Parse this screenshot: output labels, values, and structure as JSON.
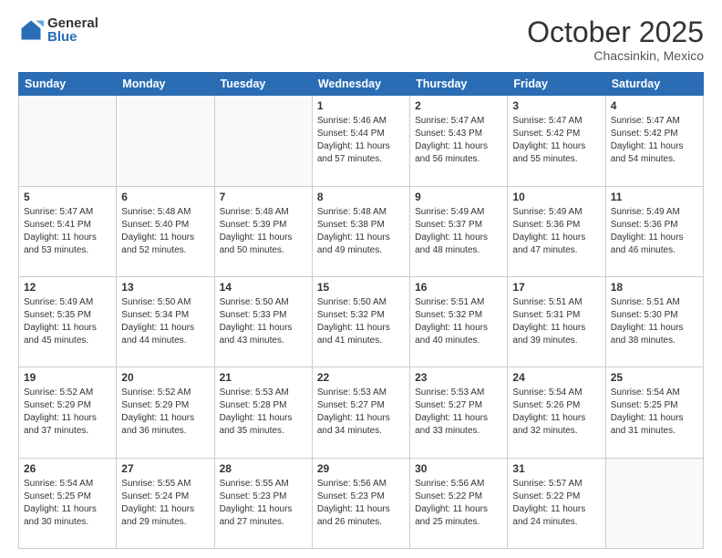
{
  "header": {
    "logo_general": "General",
    "logo_blue": "Blue",
    "month_title": "October 2025",
    "location": "Chacsinkin, Mexico"
  },
  "weekdays": [
    "Sunday",
    "Monday",
    "Tuesday",
    "Wednesday",
    "Thursday",
    "Friday",
    "Saturday"
  ],
  "weeks": [
    [
      {
        "day": "",
        "info": ""
      },
      {
        "day": "",
        "info": ""
      },
      {
        "day": "",
        "info": ""
      },
      {
        "day": "1",
        "info": "Sunrise: 5:46 AM\nSunset: 5:44 PM\nDaylight: 11 hours\nand 57 minutes."
      },
      {
        "day": "2",
        "info": "Sunrise: 5:47 AM\nSunset: 5:43 PM\nDaylight: 11 hours\nand 56 minutes."
      },
      {
        "day": "3",
        "info": "Sunrise: 5:47 AM\nSunset: 5:42 PM\nDaylight: 11 hours\nand 55 minutes."
      },
      {
        "day": "4",
        "info": "Sunrise: 5:47 AM\nSunset: 5:42 PM\nDaylight: 11 hours\nand 54 minutes."
      }
    ],
    [
      {
        "day": "5",
        "info": "Sunrise: 5:47 AM\nSunset: 5:41 PM\nDaylight: 11 hours\nand 53 minutes."
      },
      {
        "day": "6",
        "info": "Sunrise: 5:48 AM\nSunset: 5:40 PM\nDaylight: 11 hours\nand 52 minutes."
      },
      {
        "day": "7",
        "info": "Sunrise: 5:48 AM\nSunset: 5:39 PM\nDaylight: 11 hours\nand 50 minutes."
      },
      {
        "day": "8",
        "info": "Sunrise: 5:48 AM\nSunset: 5:38 PM\nDaylight: 11 hours\nand 49 minutes."
      },
      {
        "day": "9",
        "info": "Sunrise: 5:49 AM\nSunset: 5:37 PM\nDaylight: 11 hours\nand 48 minutes."
      },
      {
        "day": "10",
        "info": "Sunrise: 5:49 AM\nSunset: 5:36 PM\nDaylight: 11 hours\nand 47 minutes."
      },
      {
        "day": "11",
        "info": "Sunrise: 5:49 AM\nSunset: 5:36 PM\nDaylight: 11 hours\nand 46 minutes."
      }
    ],
    [
      {
        "day": "12",
        "info": "Sunrise: 5:49 AM\nSunset: 5:35 PM\nDaylight: 11 hours\nand 45 minutes."
      },
      {
        "day": "13",
        "info": "Sunrise: 5:50 AM\nSunset: 5:34 PM\nDaylight: 11 hours\nand 44 minutes."
      },
      {
        "day": "14",
        "info": "Sunrise: 5:50 AM\nSunset: 5:33 PM\nDaylight: 11 hours\nand 43 minutes."
      },
      {
        "day": "15",
        "info": "Sunrise: 5:50 AM\nSunset: 5:32 PM\nDaylight: 11 hours\nand 41 minutes."
      },
      {
        "day": "16",
        "info": "Sunrise: 5:51 AM\nSunset: 5:32 PM\nDaylight: 11 hours\nand 40 minutes."
      },
      {
        "day": "17",
        "info": "Sunrise: 5:51 AM\nSunset: 5:31 PM\nDaylight: 11 hours\nand 39 minutes."
      },
      {
        "day": "18",
        "info": "Sunrise: 5:51 AM\nSunset: 5:30 PM\nDaylight: 11 hours\nand 38 minutes."
      }
    ],
    [
      {
        "day": "19",
        "info": "Sunrise: 5:52 AM\nSunset: 5:29 PM\nDaylight: 11 hours\nand 37 minutes."
      },
      {
        "day": "20",
        "info": "Sunrise: 5:52 AM\nSunset: 5:29 PM\nDaylight: 11 hours\nand 36 minutes."
      },
      {
        "day": "21",
        "info": "Sunrise: 5:53 AM\nSunset: 5:28 PM\nDaylight: 11 hours\nand 35 minutes."
      },
      {
        "day": "22",
        "info": "Sunrise: 5:53 AM\nSunset: 5:27 PM\nDaylight: 11 hours\nand 34 minutes."
      },
      {
        "day": "23",
        "info": "Sunrise: 5:53 AM\nSunset: 5:27 PM\nDaylight: 11 hours\nand 33 minutes."
      },
      {
        "day": "24",
        "info": "Sunrise: 5:54 AM\nSunset: 5:26 PM\nDaylight: 11 hours\nand 32 minutes."
      },
      {
        "day": "25",
        "info": "Sunrise: 5:54 AM\nSunset: 5:25 PM\nDaylight: 11 hours\nand 31 minutes."
      }
    ],
    [
      {
        "day": "26",
        "info": "Sunrise: 5:54 AM\nSunset: 5:25 PM\nDaylight: 11 hours\nand 30 minutes."
      },
      {
        "day": "27",
        "info": "Sunrise: 5:55 AM\nSunset: 5:24 PM\nDaylight: 11 hours\nand 29 minutes."
      },
      {
        "day": "28",
        "info": "Sunrise: 5:55 AM\nSunset: 5:23 PM\nDaylight: 11 hours\nand 27 minutes."
      },
      {
        "day": "29",
        "info": "Sunrise: 5:56 AM\nSunset: 5:23 PM\nDaylight: 11 hours\nand 26 minutes."
      },
      {
        "day": "30",
        "info": "Sunrise: 5:56 AM\nSunset: 5:22 PM\nDaylight: 11 hours\nand 25 minutes."
      },
      {
        "day": "31",
        "info": "Sunrise: 5:57 AM\nSunset: 5:22 PM\nDaylight: 11 hours\nand 24 minutes."
      },
      {
        "day": "",
        "info": ""
      }
    ]
  ]
}
